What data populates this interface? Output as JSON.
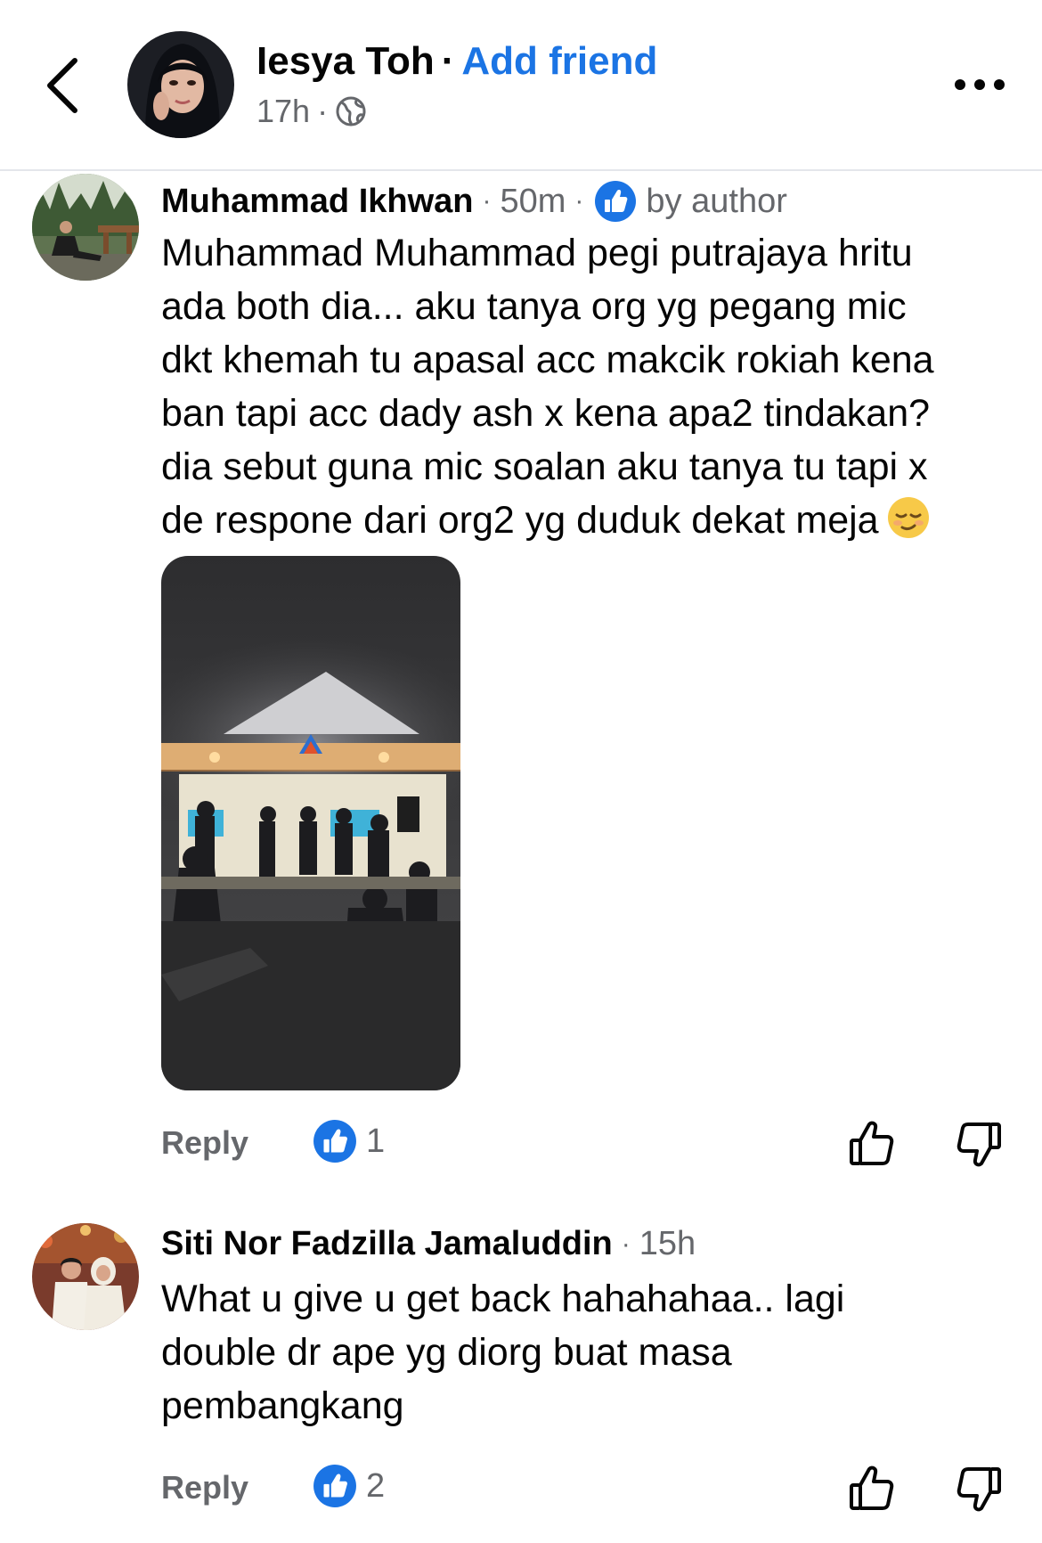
{
  "header": {
    "poster_name": "Iesya Toh",
    "separator": "·",
    "add_friend": "Add friend",
    "time": "17h",
    "time_separator": "·",
    "audience_icon": "globe-icon",
    "back_icon": "chevron-left-icon",
    "more_icon": "more-horizontal-icon"
  },
  "comments": [
    {
      "name": "Muhammad Ikhwan",
      "time_sep": "·",
      "time": "50m",
      "badge_sep": "·",
      "badge_label": "by author",
      "badge_icon": "like-badge-icon",
      "text_lines": [
        "Muhammad Muhammad  pegi putrajaya hritu",
        "ada both dia... aku tanya org yg pegang mic",
        "dkt khemah tu apasal acc makcik rokiah kena",
        "ban tapi acc dady ash x kena apa2 tindakan?",
        "dia sebut guna mic soalan aku tanya tu tapi x",
        "de respone dari org2 yg duduk dekat meja"
      ],
      "trailing_emoji": "relieved-face-emoji",
      "has_photo": true,
      "reply": "Reply",
      "reaction_count": "1"
    },
    {
      "name": "Siti Nor Fadzilla Jamaluddin",
      "time_sep": "·",
      "time": "15h",
      "text_lines": [
        "What u give u get back hahahahaa.. lagi",
        "double dr ape yg diorg buat masa",
        "pembangkang"
      ],
      "reply": "Reply",
      "reaction_count": "2"
    }
  ],
  "colors": {
    "link_blue": "#1b74e4",
    "meta_gray": "#65676b",
    "divider": "#e4e6eb"
  }
}
